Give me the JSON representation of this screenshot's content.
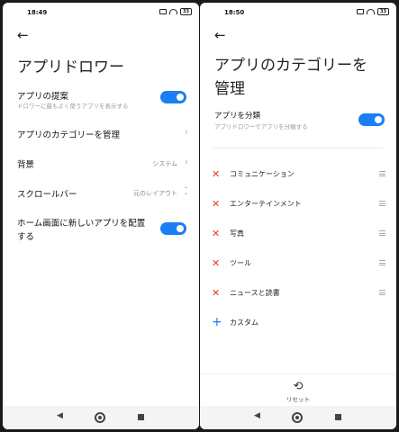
{
  "colors": {
    "accent": "#1a7ef5",
    "remove": "#e53935"
  },
  "screen1": {
    "status": {
      "time": "18:49",
      "battery": "33"
    },
    "title": "アプリドロワー",
    "suggest": {
      "title": "アプリの提案",
      "subtitle": "ドロワーに最もよく使うアプリを表示する",
      "on": true
    },
    "categories_row": "アプリのカテゴリーを管理",
    "background": {
      "title": "背景",
      "value": "システム"
    },
    "scrollbar": {
      "title": "スクロールバー",
      "value": "元のレイアウト"
    },
    "home_new_apps": {
      "line1": "ホーム画面に新しいアプリを配置",
      "line2": "する",
      "on": true
    }
  },
  "screen2": {
    "status": {
      "time": "18:50",
      "battery": "33"
    },
    "title_line1": "アプリのカテゴリーを",
    "title_line2": "管理",
    "classify": {
      "title": "アプリを分類",
      "subtitle": "アプリドロワーでアプリを分類する",
      "on": true
    },
    "categories": [
      "コミュニケーション",
      "エンターテインメント",
      "写真",
      "ツール",
      "ニュースと読書"
    ],
    "custom_label": "カスタム",
    "reset_label": "リセット"
  }
}
